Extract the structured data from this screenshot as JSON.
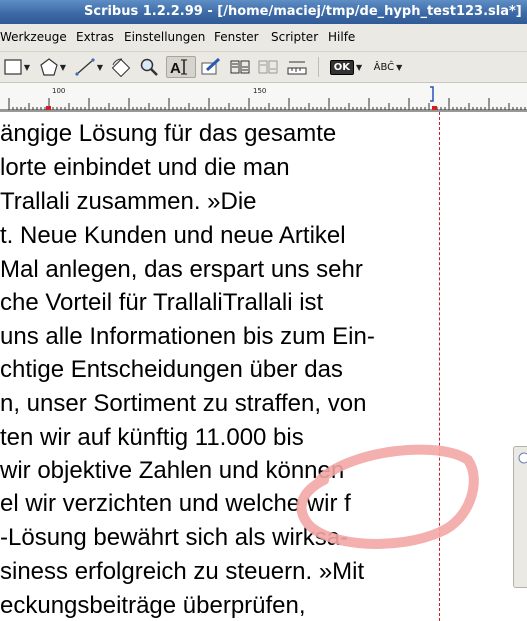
{
  "window": {
    "title": "Scribus 1.2.2.99 - [/home/maciej/tmp/de_hyph_test123.sla*]"
  },
  "menu": {
    "items": [
      "Werkzeuge",
      "Extras",
      "Einstellungen",
      "Fenster",
      "Scripter",
      "Hilfe"
    ]
  },
  "toolbar": {
    "ok_label": "OK",
    "spell_label": "ÂBĈ"
  },
  "ruler": {
    "labels": [
      "100",
      "150"
    ]
  },
  "document": {
    "lines": [
      "ängige Lösung für das gesamte",
      "lorte einbindet und die man",
      "Trallali zusammen. »Die",
      "t. Neue Kunden und neue Artikel",
      " Mal anlegen, das erspart uns sehr",
      "che Vorteil für TrallaliTrallali ist",
      "uns alle Informationen bis zum Ein-",
      "chtige Entscheidungen über das",
      "n, unser Sortiment zu straffen, von",
      "ten wir auf künftig 11.000 bis",
      " wir objektive Zahlen und können",
      "el wir verzichten und welche wir     f",
      "-Lösung bewährt sich als wirksa-",
      "siness erfolgreich zu steuern. »Mit",
      "eckungsbeiträge überprüfen,"
    ]
  },
  "colors": {
    "titlebar": "#3d6aa6",
    "margin_guide": "#cc2020",
    "annotation": "#f0a0a0"
  }
}
